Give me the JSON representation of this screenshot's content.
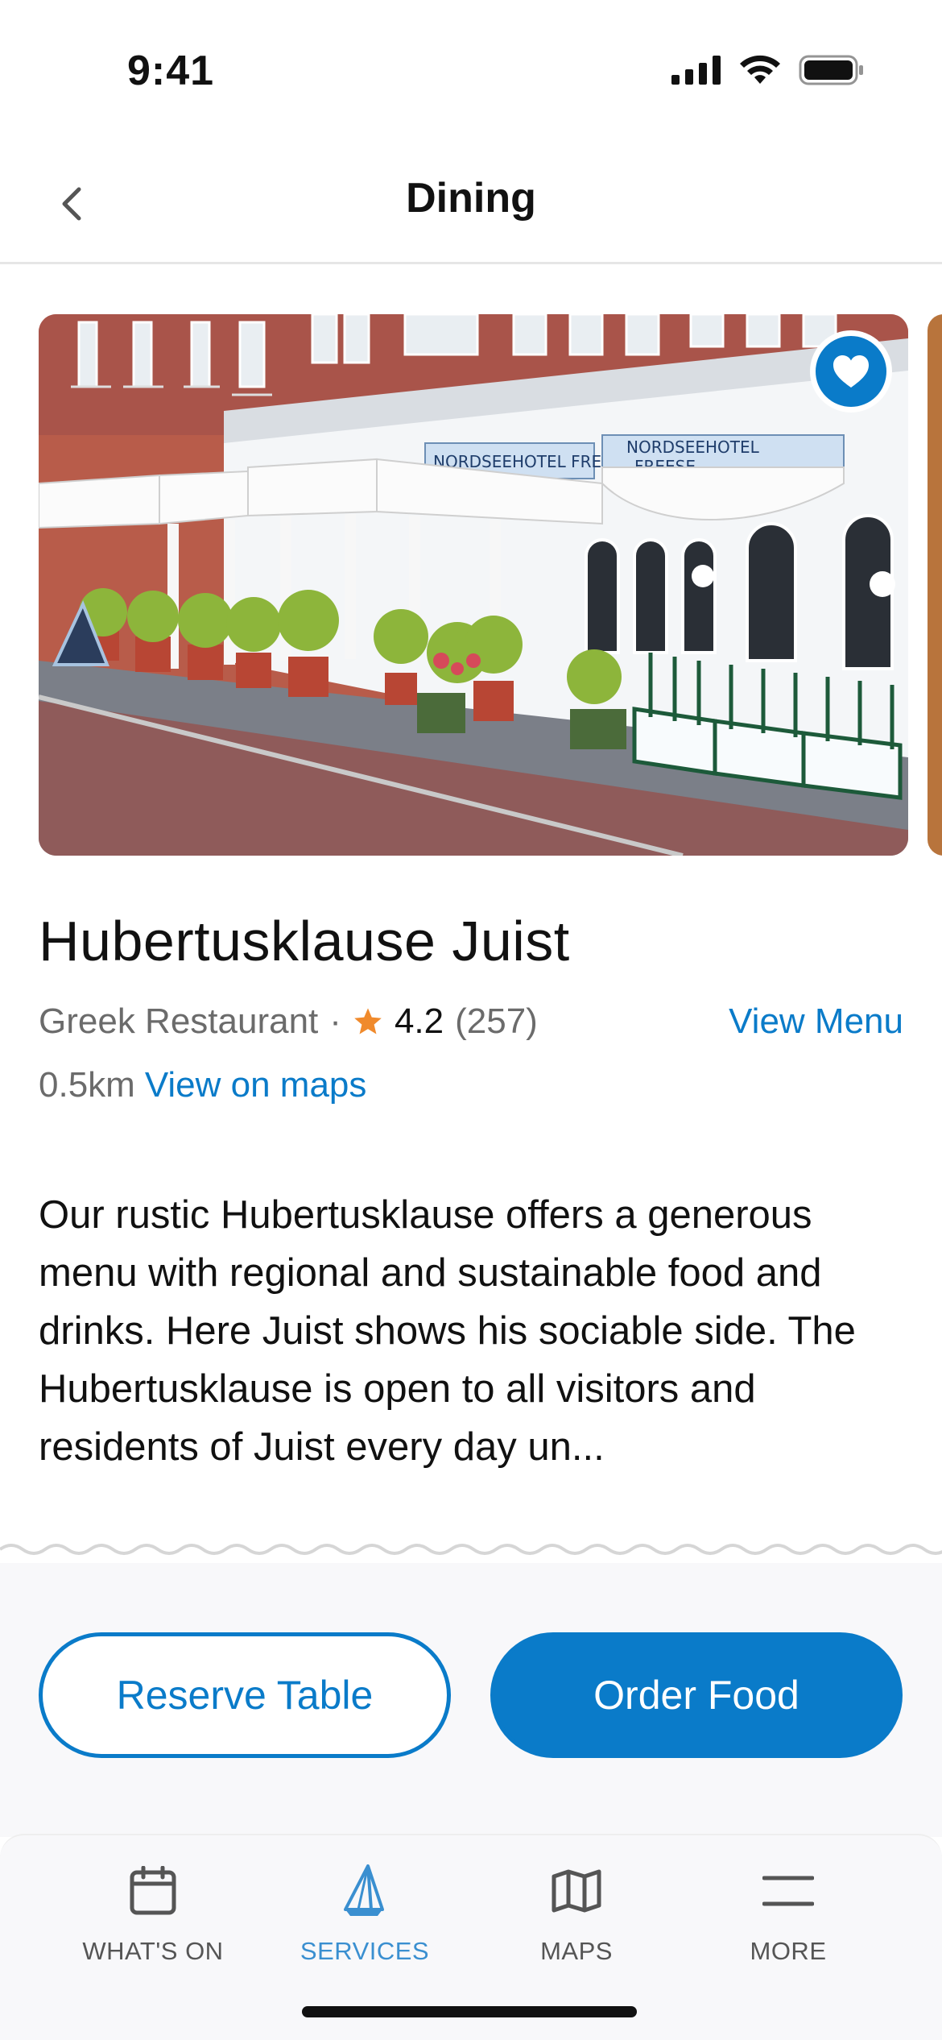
{
  "status_bar": {
    "time": "9:41"
  },
  "header": {
    "title": "Dining"
  },
  "restaurant": {
    "name": "Hubertusklause Juist",
    "category": "Greek Restaurant",
    "separator": "·",
    "rating": "4.2",
    "review_count": "(257)",
    "view_menu_label": "View Menu",
    "distance": "0.5km",
    "maps_link_label": "View on maps",
    "favorited": true,
    "description": "Our rustic Hubertusklause offers a generous menu with regional and sustainable food and drinks. Here Juist shows his sociable side. The Hubertusklause is open to all visitors and residents of Juist every day un...",
    "photo_signs": [
      "NORDSEEHOTEL FREESE",
      "NORDSEEHOTEL",
      "FREESE"
    ]
  },
  "actions": {
    "reserve_label": "Reserve Table",
    "order_label": "Order Food"
  },
  "tab_bar": {
    "tabs": [
      {
        "label": "WHAT'S ON",
        "icon": "calendar-icon",
        "active": false
      },
      {
        "label": "SERVICES",
        "icon": "sailboat-icon",
        "active": true
      },
      {
        "label": "MAPS",
        "icon": "map-icon",
        "active": false
      },
      {
        "label": "MORE",
        "icon": "menu-icon",
        "active": false
      }
    ]
  },
  "colors": {
    "accent": "#0a7bc9",
    "star": "#f08a2c",
    "muted_text": "#6b6b6b",
    "active_tab": "#3a8fd0"
  }
}
